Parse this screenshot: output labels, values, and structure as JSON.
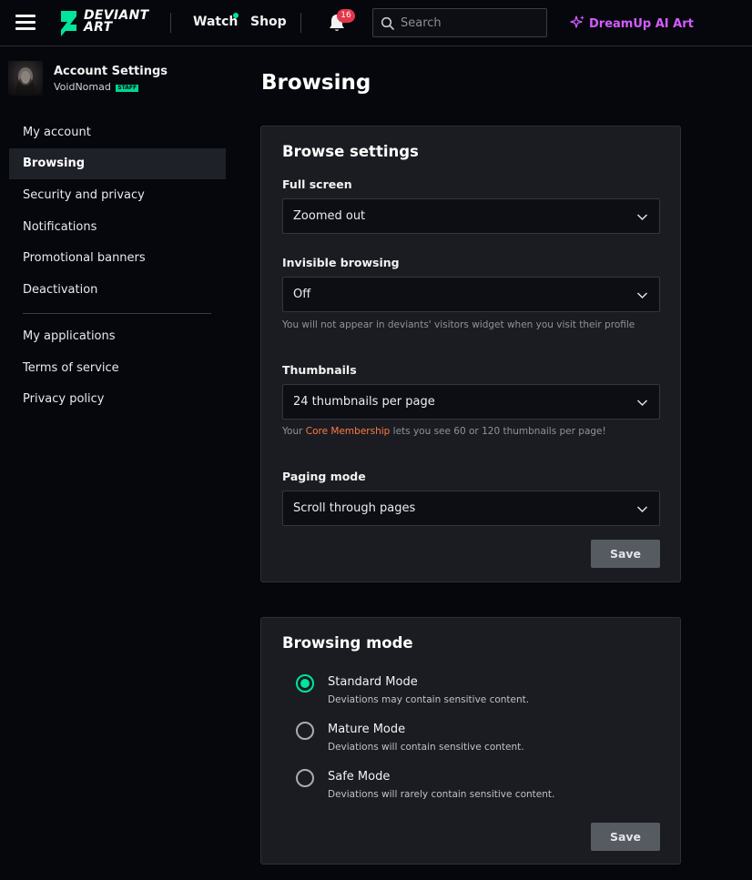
{
  "header": {
    "logo_text_line1": "DEVIANT",
    "logo_text_line2": "ART",
    "watch_label": "Watch",
    "shop_label": "Shop",
    "notification_count": "16",
    "search_placeholder": "Search",
    "dreamup_label": "DreamUp AI Art",
    "colors": {
      "brand_green": "#00e59b",
      "dreamup_purple": "#d55cff",
      "badge_red": "#e3364a"
    },
    "icons": [
      "hamburger-menu-icon",
      "deviantart-logo-icon",
      "bell-icon",
      "search-icon",
      "sparkle-icon"
    ]
  },
  "sidebar": {
    "account_title": "Account Settings",
    "username": "VoidNomad",
    "staff_badge": "STAFF",
    "items": [
      {
        "label": "My account",
        "active": false
      },
      {
        "label": "Browsing",
        "active": true
      },
      {
        "label": "Security and privacy",
        "active": false
      },
      {
        "label": "Notifications",
        "active": false
      },
      {
        "label": "Promotional banners",
        "active": false
      },
      {
        "label": "Deactivation",
        "active": false
      }
    ],
    "secondary_items": [
      {
        "label": "My applications"
      },
      {
        "label": "Terms of service"
      },
      {
        "label": "Privacy policy"
      }
    ]
  },
  "main": {
    "page_title": "Browsing",
    "browse_settings": {
      "title": "Browse settings",
      "full_screen": {
        "label": "Full screen",
        "value": "Zoomed out"
      },
      "invisible_browsing": {
        "label": "Invisible browsing",
        "value": "Off",
        "help": "You will not appear in deviants' visitors widget when you visit their profile"
      },
      "thumbnails": {
        "label": "Thumbnails",
        "value": "24 thumbnails per page",
        "help_prefix": "Your ",
        "help_link": "Core Membership",
        "help_suffix": " lets you see 60 or 120 thumbnails per page!"
      },
      "paging_mode": {
        "label": "Paging mode",
        "value": "Scroll through pages"
      },
      "save_label": "Save"
    },
    "browsing_mode": {
      "title": "Browsing mode",
      "options": [
        {
          "label": "Standard Mode",
          "description": "Deviations may contain sensitive content.",
          "selected": true
        },
        {
          "label": "Mature Mode",
          "description": "Deviations will contain sensitive content.",
          "selected": false
        },
        {
          "label": "Safe Mode",
          "description": "Deviations will rarely contain sensitive content.",
          "selected": false
        }
      ],
      "save_label": "Save"
    }
  }
}
